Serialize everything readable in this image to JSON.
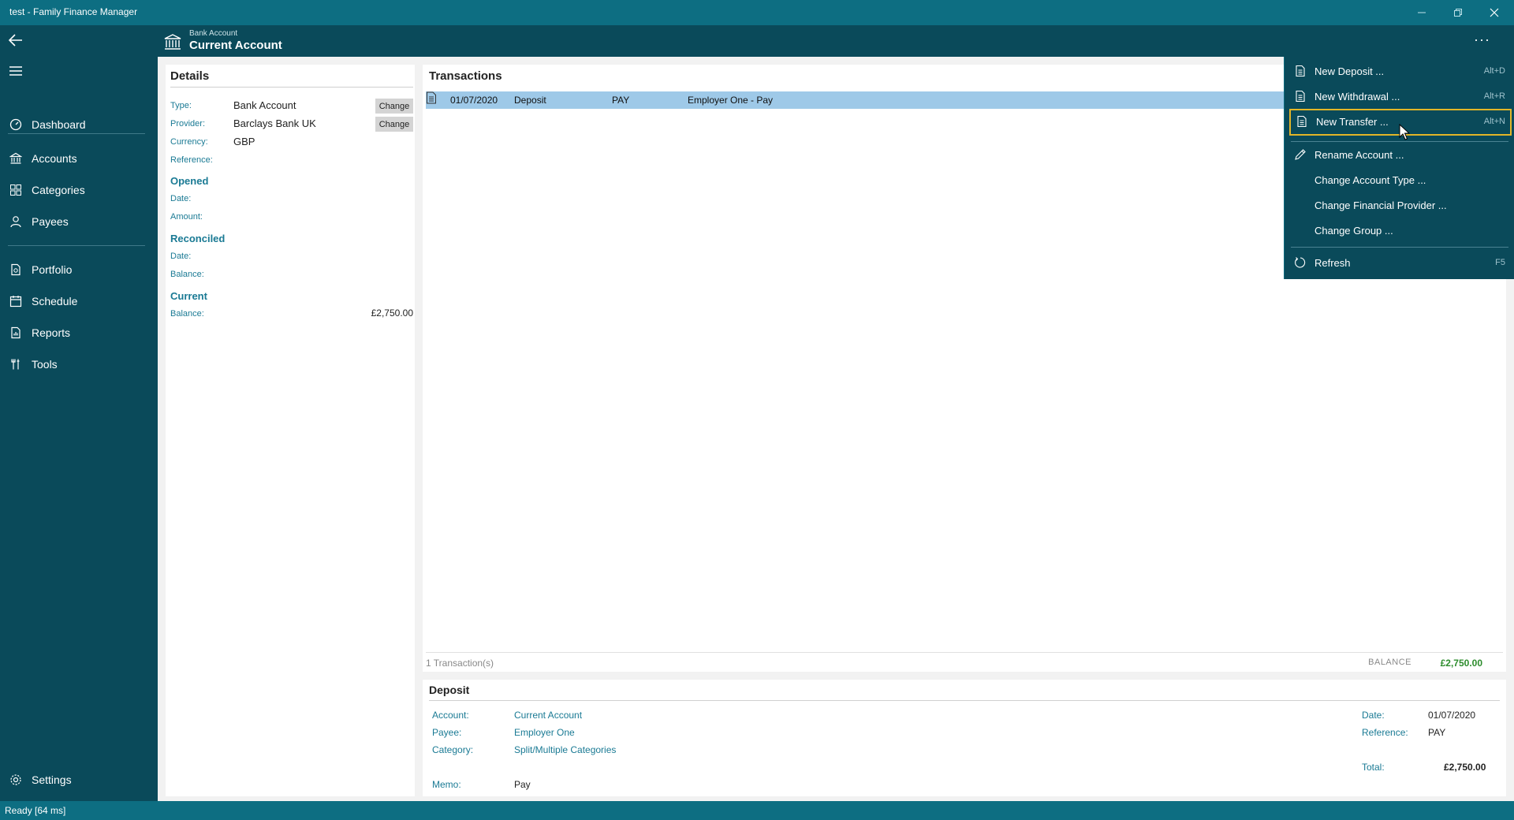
{
  "window": {
    "title": "test - Family Finance Manager"
  },
  "nav": {
    "items": [
      {
        "label": "Dashboard",
        "icon": "dashboard-icon"
      },
      {
        "label": "Accounts",
        "icon": "bank-icon"
      },
      {
        "label": "Categories",
        "icon": "categories-icon"
      },
      {
        "label": "Payees",
        "icon": "person-icon"
      },
      {
        "label": "Portfolio",
        "icon": "portfolio-icon"
      },
      {
        "label": "Schedule",
        "icon": "calendar-icon"
      },
      {
        "label": "Reports",
        "icon": "report-icon"
      },
      {
        "label": "Tools",
        "icon": "tools-icon"
      }
    ],
    "settings_label": "Settings"
  },
  "header": {
    "subtitle": "Bank Account",
    "title": "Current Account",
    "more": "···"
  },
  "details": {
    "title": "Details",
    "type_label": "Type:",
    "type_value": "Bank Account",
    "provider_label": "Provider:",
    "provider_value": "Barclays Bank UK",
    "currency_label": "Currency:",
    "currency_value": "GBP",
    "reference_label": "Reference:",
    "change_label": "Change",
    "opened": "Opened",
    "opened_date_label": "Date:",
    "opened_amount_label": "Amount:",
    "reconciled": "Reconciled",
    "reconciled_date_label": "Date:",
    "reconciled_balance_label": "Balance:",
    "current": "Current",
    "current_balance_label": "Balance:",
    "current_balance_value": "£2,750.00"
  },
  "transactions": {
    "title": "Transactions",
    "rows": [
      {
        "date": "01/07/2020",
        "type": "Deposit",
        "reference": "PAY",
        "description": "Employer One - Pay"
      }
    ],
    "count": "1 Transaction(s)",
    "balance_label": "BALANCE",
    "balance_value": "£2,750.00"
  },
  "deposit": {
    "title": "Deposit",
    "account_label": "Account:",
    "account_value": "Current Account",
    "payee_label": "Payee:",
    "payee_value": "Employer One",
    "category_label": "Category:",
    "category_value": "Split/Multiple Categories",
    "memo_label": "Memo:",
    "memo_value": "Pay",
    "date_label": "Date:",
    "date_value": "01/07/2020",
    "reference_label": "Reference:",
    "reference_value": "PAY",
    "total_label": "Total:",
    "total_value": "£2,750.00"
  },
  "menu": {
    "new_deposit": {
      "label": "New Deposit ...",
      "shortcut": "Alt+D"
    },
    "new_withdrawal": {
      "label": "New Withdrawal ...",
      "shortcut": "Alt+R"
    },
    "new_transfer": {
      "label": "New Transfer ...",
      "shortcut": "Alt+N"
    },
    "rename_account": {
      "label": "Rename Account ..."
    },
    "change_account_type": {
      "label": "Change Account Type ..."
    },
    "change_financial_provider": {
      "label": "Change Financial Provider ..."
    },
    "change_group": {
      "label": "Change Group ..."
    },
    "refresh": {
      "label": "Refresh",
      "shortcut": "F5"
    }
  },
  "status": {
    "text": "Ready [64 ms]"
  },
  "colors": {
    "accent": "#0d6e82",
    "sidebar": "#0a4a5a",
    "highlight": "#e2b628",
    "selection": "#9ec9e8",
    "label": "#1a7a94",
    "positive": "#2c8c2c"
  }
}
